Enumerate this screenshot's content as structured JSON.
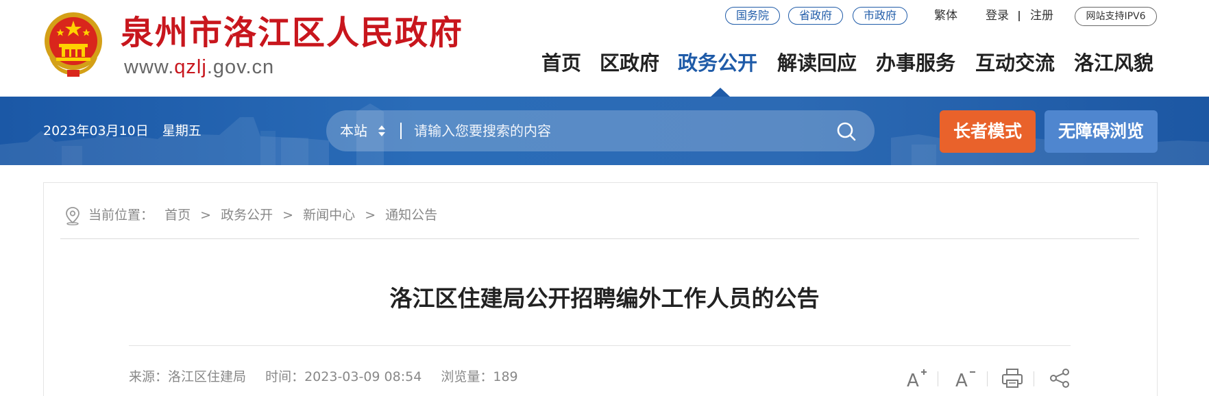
{
  "header": {
    "site_title": "泉州市洛江区人民政府",
    "url_prefix": "www.",
    "url_highlight": "qzlj",
    "url_suffix": ".gov.cn",
    "top_links": {
      "guowuyuan": "国务院",
      "shengzhengfu": "省政府",
      "shizhengfu": "市政府",
      "traditional": "繁体",
      "login": "登录",
      "register": "注册",
      "ipv6": "网站支持IPV6"
    },
    "nav": [
      "首页",
      "区政府",
      "政务公开",
      "解读回应",
      "办事服务",
      "互动交流",
      "洛江风貌"
    ],
    "nav_active": "政务公开"
  },
  "banner": {
    "date": "2023年03月10日",
    "weekday": "星期五",
    "search_scope": "本站",
    "search_placeholder": "请输入您要搜索的内容",
    "elder_mode": "长者模式",
    "accessible": "无障碍浏览"
  },
  "breadcrumb": {
    "label": "当前位置：",
    "items": [
      "首页",
      "政务公开",
      "新闻中心",
      "通知公告"
    ],
    "separator": ">"
  },
  "article": {
    "title": "洛江区住建局公开招聘编外工作人员的公告",
    "source_label": "来源：",
    "source": "洛江区住建局",
    "time_label": "时间：",
    "time": "2023-03-09 08:54",
    "views_label": "浏览量：",
    "views": "189"
  },
  "icons": {
    "emblem": "national-emblem-icon",
    "search": "search-icon",
    "location": "location-pin-icon",
    "font_up": "font-increase-icon",
    "font_down": "font-decrease-icon",
    "print": "print-icon",
    "share": "share-icon"
  },
  "colors": {
    "brand_red": "#c8161d",
    "brand_blue": "#1f5ba8",
    "elder_orange": "#e9622b",
    "access_blue": "#4f86cf"
  }
}
